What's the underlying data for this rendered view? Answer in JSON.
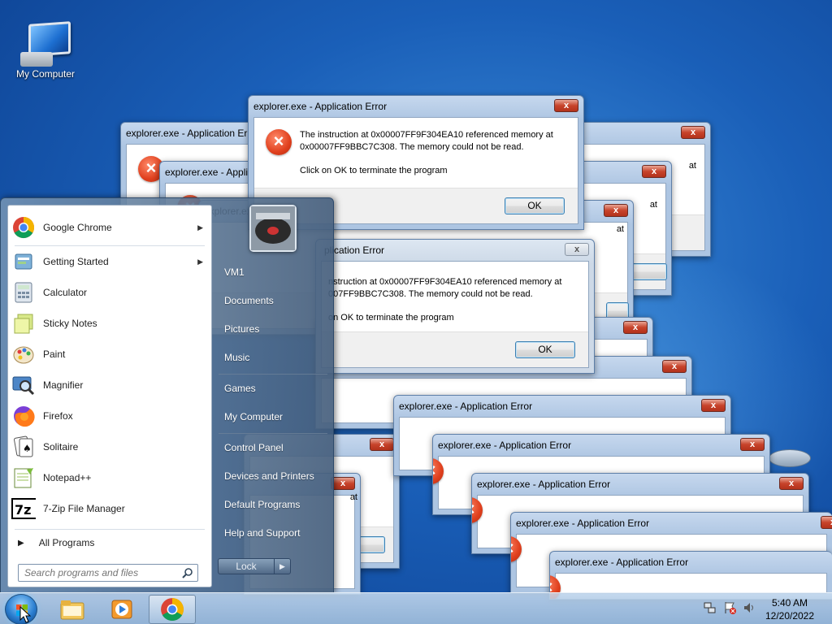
{
  "desktop": {
    "icons": [
      {
        "label": "My Computer",
        "icon": "computer-icon"
      },
      {
        "label": "",
        "icon": "recycle-bin-icon"
      }
    ]
  },
  "dialogs": {
    "title": "explorer.exe - Application Error",
    "title_clipped": "plication Error",
    "message_line1": "The instruction at 0x00007FF9F304EA10 referenced memory at",
    "message_line2": "0x00007FF9BBC7C308. The memory could not be read.",
    "message_line3": "Click on OK to terminate the program",
    "clip_line1": "nstruction at 0x00007FF9F304EA10 referenced memory at",
    "clip_line2": "007FF9BBC7C308. The memory could not be read.",
    "clip_line3": "on OK to terminate the program",
    "partial_at": "at",
    "close_glyph": "x",
    "ok_label": "OK",
    "error_glyph": "×"
  },
  "start_menu": {
    "programs": [
      {
        "label": "Google Chrome",
        "icon": "chrome-icon",
        "has_submenu": true
      },
      {
        "label": "Getting Started",
        "icon": "getting-started-icon",
        "has_submenu": true
      },
      {
        "label": "Calculator",
        "icon": "calculator-icon",
        "has_submenu": false
      },
      {
        "label": "Sticky Notes",
        "icon": "sticky-notes-icon",
        "has_submenu": false
      },
      {
        "label": "Paint",
        "icon": "paint-icon",
        "has_submenu": false
      },
      {
        "label": "Magnifier",
        "icon": "magnifier-icon",
        "has_submenu": false
      },
      {
        "label": "Firefox",
        "icon": "firefox-icon",
        "has_submenu": false
      },
      {
        "label": "Solitaire",
        "icon": "solitaire-icon",
        "has_submenu": false
      },
      {
        "label": "Notepad++",
        "icon": "notepadpp-icon",
        "has_submenu": false
      },
      {
        "label": "7-Zip File Manager",
        "icon": "7zip-icon",
        "has_submenu": false
      }
    ],
    "submenu_arrow": "▶",
    "all_programs": "All Programs",
    "all_programs_arrow": "▶",
    "search_placeholder": "Search programs and files",
    "right_items": [
      "VM1",
      "Documents",
      "Pictures",
      "Music",
      "Games",
      "My Computer",
      "Control Panel",
      "Devices and Printers",
      "Default Programs",
      "Help and Support"
    ],
    "lock_label": "Lock",
    "lock_arrow": "▶"
  },
  "taskbar": {
    "apps": [
      {
        "name": "windows-explorer",
        "icon": "folder-icon",
        "active": false
      },
      {
        "name": "media-player",
        "icon": "media-player-icon",
        "active": false
      },
      {
        "name": "google-chrome",
        "icon": "chrome-icon",
        "active": true
      }
    ],
    "clock_time": "5:40 AM",
    "clock_date": "12/20/2022"
  },
  "colors": {
    "error_red": "#e0401e",
    "close_red": "#c7432b",
    "desktop_blue": "#1a5fb8",
    "chrome_red": "#db4437",
    "chrome_yellow": "#f4b400",
    "chrome_green": "#0f9d58",
    "chrome_blue": "#4285f4"
  }
}
